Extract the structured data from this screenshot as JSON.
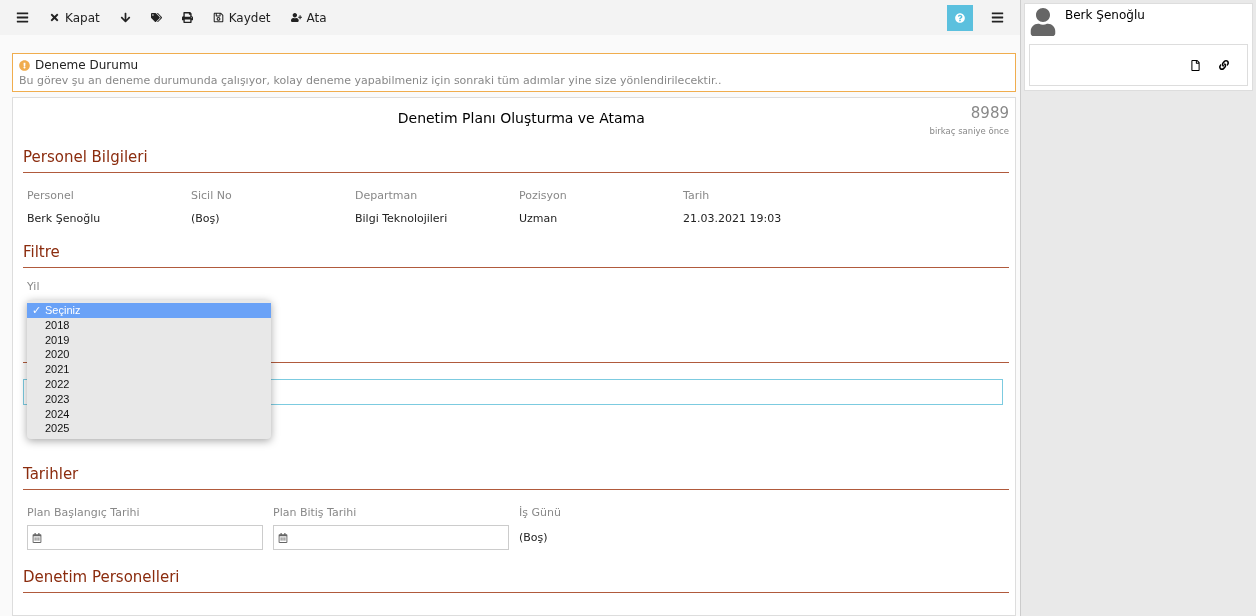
{
  "toolbar": {
    "items": [
      {
        "kind": "menu"
      },
      {
        "kind": "close",
        "label": "Kapat"
      },
      {
        "kind": "download"
      },
      {
        "kind": "tags"
      },
      {
        "kind": "print"
      },
      {
        "kind": "save",
        "label": "Kaydet"
      },
      {
        "kind": "assign",
        "label": "Ata"
      }
    ]
  },
  "alert": {
    "title": "Deneme Durumu",
    "text": "Bu görev şu an deneme durumunda çalışıyor, kolay deneme yapabilmeniz için sonraki tüm adımlar yine size yönlendirilecektir.."
  },
  "form": {
    "title": "Denetim Planı Oluşturma ve Atama",
    "number": "8989",
    "time": "birkaç saniye önce",
    "personnel": {
      "heading": "Personel Bilgileri",
      "columns": [
        {
          "label": "Personel",
          "value": "Berk Şenoğlu"
        },
        {
          "label": "Sicil No",
          "value": "(Boş)"
        },
        {
          "label": "Departman",
          "value": "Bilgi Teknolojileri"
        },
        {
          "label": "Pozisyon",
          "value": "Uzman"
        },
        {
          "label": "Tarih",
          "value": "21.03.2021 19:03"
        }
      ]
    },
    "filter": {
      "heading": "Filtre",
      "label": "Yil",
      "options": [
        {
          "label": "Seçiniz",
          "selected": true,
          "mark": "✓"
        },
        {
          "label": "2018",
          "selected": false
        },
        {
          "label": "2019",
          "selected": false
        },
        {
          "label": "2020",
          "selected": false
        },
        {
          "label": "2021",
          "selected": false
        },
        {
          "label": "2022",
          "selected": false
        },
        {
          "label": "2023",
          "selected": false
        },
        {
          "label": "2024",
          "selected": false
        },
        {
          "label": "2025",
          "selected": false
        }
      ]
    },
    "dates": {
      "heading": "Tarihler",
      "start_label": "Plan Başlangıç Tarihi",
      "end_label": "Plan Bitiş Tarihi",
      "days_label": "İş Günü",
      "days_value": "(Boş)"
    },
    "staff": {
      "heading": "Denetim Personelleri"
    }
  },
  "sidebar": {
    "user": "Berk Şenoğlu"
  }
}
